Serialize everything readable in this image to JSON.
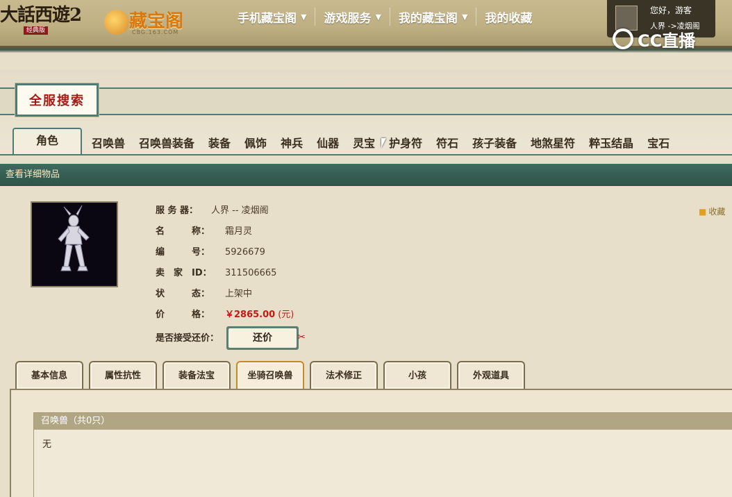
{
  "header": {
    "game_logo": "大話西遊2",
    "game_logo_sub": "经典版",
    "site_logo": "藏宝阁",
    "site_url": "CBG.163.COM",
    "nav": [
      {
        "label": "手机藏宝阁",
        "caret": "▼"
      },
      {
        "label": "游戏服务",
        "caret": "▼"
      },
      {
        "label": "我的藏宝阁",
        "caret": "▼"
      },
      {
        "label": "我的收藏",
        "caret": ""
      }
    ],
    "user": {
      "greeting": "您好，游客",
      "server": "人界 ->凌烟阁"
    },
    "watermark": "CC直播"
  },
  "search": {
    "title": "全服搜索",
    "tabs": [
      "角色",
      "召唤兽",
      "召唤兽装备",
      "装备",
      "佩饰",
      "神兵",
      "仙器",
      "灵宝",
      "护身符",
      "符石",
      "孩子装备",
      "地煞星符",
      "粹玉结晶",
      "宝石"
    ],
    "active_tab": "角色"
  },
  "detail": {
    "bar_title": "查看详细物品",
    "favorite_label": "收藏",
    "rows": {
      "server": {
        "label": "服 务 器：",
        "value": "人界 -- 凌烟阁"
      },
      "name": {
        "label": "名　　　称：",
        "value": "霜月灵"
      },
      "number": {
        "label": "编　　　号：",
        "value": "5926679"
      },
      "seller": {
        "label": "卖　家　ID：",
        "value": "311506665"
      },
      "status": {
        "label": "状　　　态：",
        "value": "上架中"
      },
      "price": {
        "label": "价　　　格：",
        "value": "￥2865.00",
        "unit": "(元)"
      },
      "counter": {
        "label": "是否接受还价：",
        "button": "还价"
      }
    },
    "subtabs": [
      "基本信息",
      "属性抗性",
      "装备法宝",
      "坐骑召唤兽",
      "法术修正",
      "小孩",
      "外观道具"
    ],
    "active_subtab": "坐骑召唤兽",
    "pet_box": {
      "title": "召唤兽（共0只）",
      "body": "无"
    }
  },
  "colors": {
    "accent_teal": "#4f7b76",
    "price_red": "#c31a12",
    "header_brown": "#bfb083"
  }
}
